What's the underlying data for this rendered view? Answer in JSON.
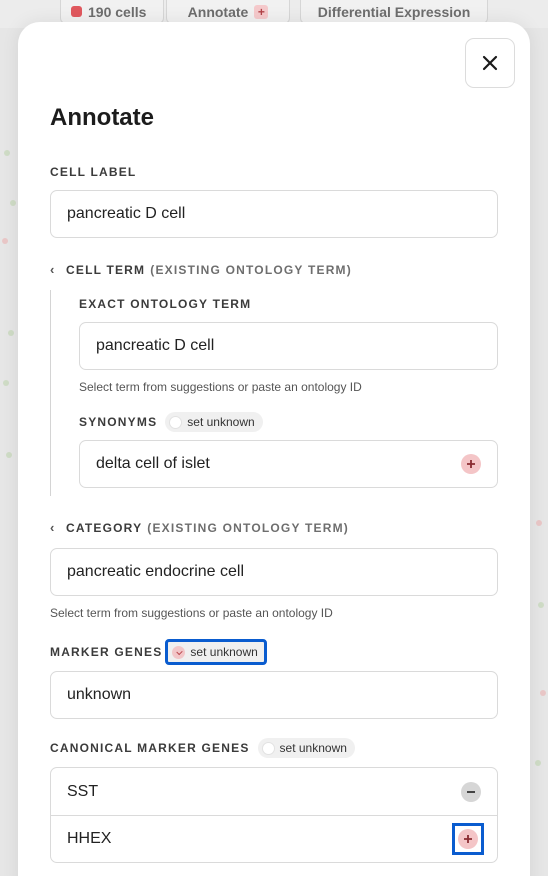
{
  "background": {
    "cell_count": "190 cells",
    "tabs": [
      {
        "label": "Annotate"
      },
      {
        "label": "Differential Expression"
      }
    ]
  },
  "modal": {
    "title": "Annotate",
    "close_icon": "close-icon",
    "cell_label": {
      "label": "CELL LABEL",
      "value": "pancreatic D cell"
    },
    "cell_term": {
      "label": "CELL TERM",
      "sublabel": "(EXISTING ONTOLOGY TERM)",
      "exact_term": {
        "label": "EXACT ONTOLOGY TERM",
        "value": "pancreatic D cell",
        "hint": "Select term from suggestions or paste an ontology ID"
      },
      "synonyms": {
        "label": "SYNONYMS",
        "unknown_label": "set unknown",
        "value": "delta cell of islet"
      }
    },
    "category": {
      "label": "CATEGORY",
      "sublabel": "(EXISTING ONTOLOGY TERM)",
      "value": "pancreatic endocrine cell",
      "hint": "Select term from suggestions or paste an ontology ID"
    },
    "marker_genes": {
      "label": "MARKER GENES",
      "unknown_label": "set unknown",
      "unknown_checked": true,
      "value": "unknown"
    },
    "canonical_marker_genes": {
      "label": "CANONICAL MARKER GENES",
      "unknown_label": "set unknown",
      "rows": [
        {
          "value": "SST",
          "action": "minus"
        },
        {
          "value": "HHEX",
          "action": "plus"
        }
      ]
    }
  },
  "colors": {
    "accent_pink": "#f4c5c7",
    "highlight_blue": "#0a5ccf",
    "cell_dot": "#e0585e"
  }
}
